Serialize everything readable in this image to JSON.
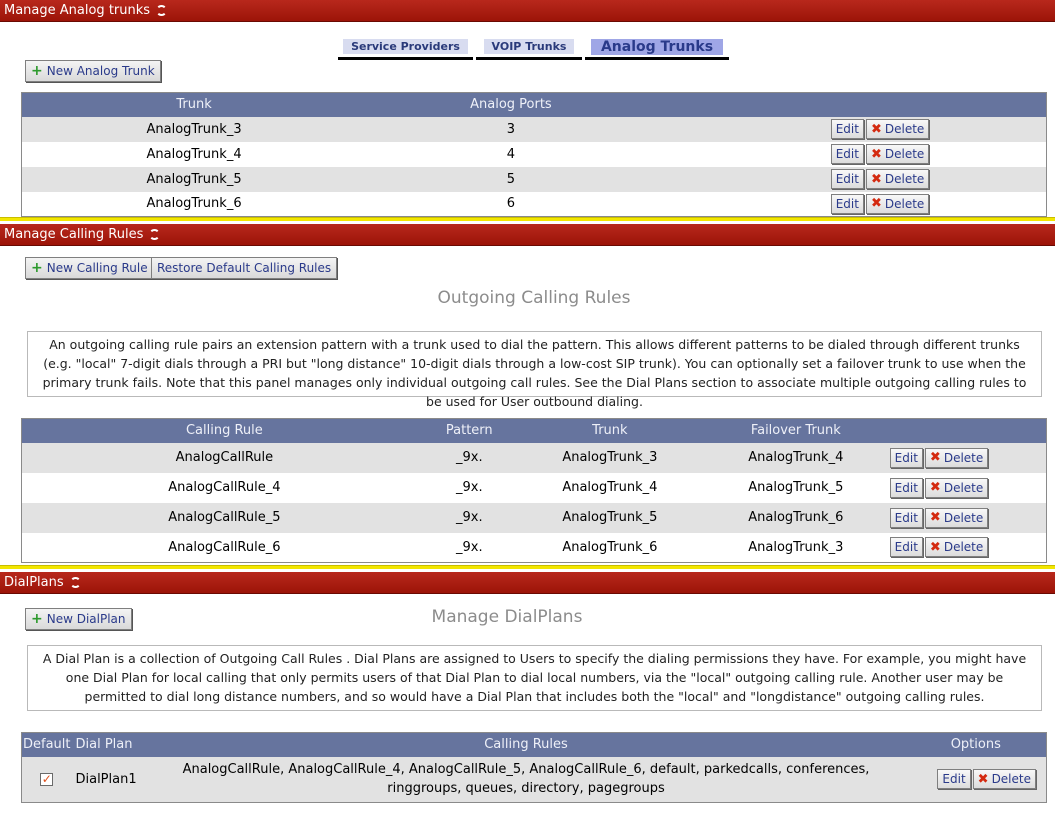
{
  "analog_section": {
    "title": "Manage Analog trunks",
    "tabs": [
      {
        "label": "Service Providers",
        "active": false
      },
      {
        "label": "VOIP Trunks",
        "active": false
      },
      {
        "label": "Analog Trunks",
        "active": true
      }
    ],
    "new_button": "New Analog Trunk",
    "columns": [
      "Trunk",
      "Analog Ports"
    ],
    "rows": [
      {
        "trunk": "AnalogTrunk_3",
        "ports": "3"
      },
      {
        "trunk": "AnalogTrunk_4",
        "ports": "4"
      },
      {
        "trunk": "AnalogTrunk_5",
        "ports": "5"
      },
      {
        "trunk": "AnalogTrunk_6",
        "ports": "6"
      }
    ]
  },
  "actions": {
    "edit": "Edit",
    "delete": "Delete"
  },
  "calling_section": {
    "title": "Manage Calling Rules",
    "new_button": "New Calling Rule",
    "restore_button": "Restore Default Calling Rules",
    "heading": "Outgoing Calling Rules",
    "description": "An outgoing calling rule pairs an extension pattern with a trunk used to dial the pattern. This allows different patterns to be dialed through different trunks (e.g. \"local\" 7-digit dials through a PRI but \"long distance\" 10-digit dials through a low-cost SIP trunk). You can optionally set a failover trunk to use when the primary trunk fails. Note that this panel manages only individual outgoing call rules. See the Dial Plans section to associate multiple outgoing calling rules to be used for User outbound dialing.",
    "columns": [
      "Calling Rule",
      "Pattern",
      "Trunk",
      "Failover Trunk"
    ],
    "rows": [
      {
        "rule": "AnalogCallRule",
        "pattern": "_9x.",
        "trunk": "AnalogTrunk_3",
        "failover": "AnalogTrunk_4"
      },
      {
        "rule": "AnalogCallRule_4",
        "pattern": "_9x.",
        "trunk": "AnalogTrunk_4",
        "failover": "AnalogTrunk_5"
      },
      {
        "rule": "AnalogCallRule_5",
        "pattern": "_9x.",
        "trunk": "AnalogTrunk_5",
        "failover": "AnalogTrunk_6"
      },
      {
        "rule": "AnalogCallRule_6",
        "pattern": "_9x.",
        "trunk": "AnalogTrunk_6",
        "failover": "AnalogTrunk_3"
      }
    ]
  },
  "dialplan_section": {
    "title": "DialPlans",
    "new_button": "New DialPlan",
    "heading": "Manage DialPlans",
    "description": "A Dial Plan is a collection of Outgoing Call Rules . Dial Plans are assigned to Users to specify the dialing permissions they have. For example, you might have one Dial Plan for local calling that only permits users of that Dial Plan to dial local numbers, via the \"local\" outgoing calling rule. Another user may be permitted to dial long distance numbers, and so would have a Dial Plan that includes both the \"local\" and \"longdistance\" outgoing calling rules.",
    "columns": [
      "Default",
      "Dial Plan",
      "Calling Rules",
      "Options"
    ],
    "rows": [
      {
        "default": true,
        "plan": "DialPlan1",
        "rules": "AnalogCallRule, AnalogCallRule_4, AnalogCallRule_5, AnalogCallRule_6, default, parkedcalls, conferences, ringgroups, queues, directory, pagegroups"
      }
    ]
  },
  "colors": {
    "section_bar": "#b01e12",
    "table_header": "#66749e",
    "separator": "#f2e600",
    "link_text": "#2a3a8a"
  }
}
